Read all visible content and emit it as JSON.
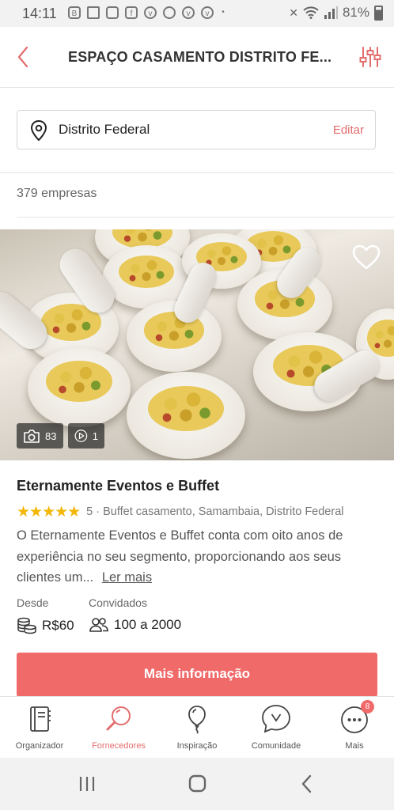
{
  "status_bar": {
    "time": "14:11",
    "battery": "81%"
  },
  "header": {
    "title": "ESPAÇO CASAMENTO DISTRITO FE..."
  },
  "location": {
    "value": "Distrito Federal",
    "edit_label": "Editar"
  },
  "results": {
    "count_text": "379 empresas"
  },
  "vendor": {
    "photo_count": "83",
    "video_count": "1",
    "name": "Eternamente Eventos e Buffet",
    "rating": 5,
    "rating_text": "5",
    "meta": "· Buffet casamento, Samambaia, Distrito Federal",
    "description": "O Eternamente Eventos e Buffet conta com oito anos de experiência no seu segmento, proporcionando aos seus clientes um...",
    "read_more": "Ler mais",
    "price_label": "Desde",
    "price": "R$60",
    "guests_label": "Convidados",
    "guests": "100 a 2000",
    "cta_label": "Mais informação"
  },
  "tabs": [
    {
      "label": "Organizador",
      "icon": "notebook-icon"
    },
    {
      "label": "Fornecedores",
      "icon": "search-icon",
      "active": true
    },
    {
      "label": "Inspiração",
      "icon": "balloon-icon"
    },
    {
      "label": "Comunidade",
      "icon": "chat-bubble-icon"
    },
    {
      "label": "Mais",
      "icon": "more-icon",
      "badge": "8"
    }
  ],
  "colors": {
    "accent": "#f06a6a",
    "star": "#f2b707"
  }
}
